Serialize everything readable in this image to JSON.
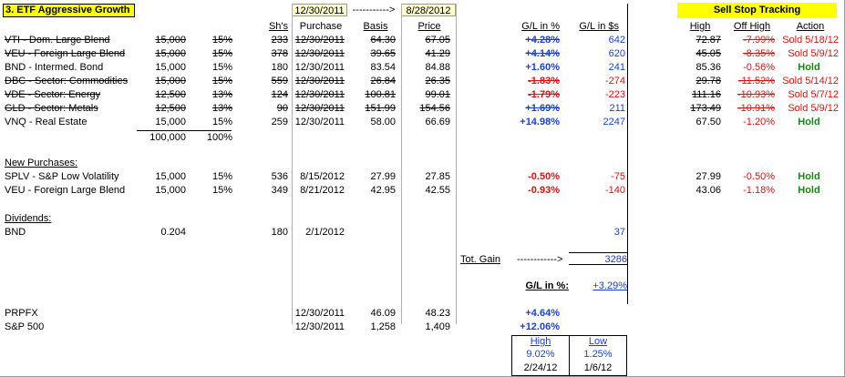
{
  "title": "3. ETF Aggressive Growth",
  "header": {
    "start_date": "12/30/2011",
    "arrow": "----------->",
    "end_date": "8/28/2012",
    "shares_label": "Sh's",
    "purchase_label": "Purchase",
    "basis_label": "Basis",
    "price_label": "Price",
    "gl_pct_label": "G/L in %",
    "gl_usd_label": "G/L in $s"
  },
  "sell_stop": {
    "title": "Sell Stop Tracking",
    "high_label": "High",
    "off_high_label": "Off High",
    "action_label": "Action"
  },
  "holdings": [
    {
      "name": "VTI - Dom. Large Blend",
      "amount": "15,000",
      "pct": "15%",
      "shares": "233",
      "purchase": "12/30/2011",
      "basis": "64.30",
      "price": "67.05",
      "gl_pct": "+4.28%",
      "gl_usd": "642",
      "high": "72.87",
      "off_high": "-7.99%",
      "action": "Sold 5/18/12",
      "struck": true
    },
    {
      "name": "VEU - Foreign Large Blend",
      "amount": "15,000",
      "pct": "15%",
      "shares": "378",
      "purchase": "12/30/2011",
      "basis": "39.65",
      "price": "41.29",
      "gl_pct": "+4.14%",
      "gl_usd": "620",
      "high": "45.05",
      "off_high": "-8.35%",
      "action": "Sold 5/9/12",
      "struck": true
    },
    {
      "name": "BND - Intermed. Bond",
      "amount": "15,000",
      "pct": "15%",
      "shares": "180",
      "purchase": "12/30/2011",
      "basis": "83.54",
      "price": "84.88",
      "gl_pct": "+1.60%",
      "gl_usd": "241",
      "high": "85.36",
      "off_high": "-0.56%",
      "action": "Hold",
      "struck": false
    },
    {
      "name": "DBC - Sector: Commodities",
      "amount": "15,000",
      "pct": "15%",
      "shares": "559",
      "purchase": "12/30/2011",
      "basis": "26.84",
      "price": "26.35",
      "gl_pct": "-1.83%",
      "gl_usd": "-274",
      "high": "29.78",
      "off_high": "-11.52%",
      "action": "Sold 5/14/12",
      "struck": true
    },
    {
      "name": "VDE - Sector: Energy",
      "amount": "12,500",
      "pct": "13%",
      "shares": "124",
      "purchase": "12/30/2011",
      "basis": "100.81",
      "price": "99.01",
      "gl_pct": "-1.79%",
      "gl_usd": "-223",
      "high": "111.16",
      "off_high": "-10.93%",
      "action": "Sold 5/7/12",
      "struck": true
    },
    {
      "name": "GLD - Sector: Metals",
      "amount": "12,500",
      "pct": "13%",
      "shares": "90",
      "purchase": "12/30/2011",
      "basis": "151.99",
      "price": "154.56",
      "gl_pct": "+1.69%",
      "gl_usd": "211",
      "high": "173.49",
      "off_high": "-10.91%",
      "action": "Sold 5/9/12",
      "struck": true
    },
    {
      "name": "VNQ - Real Estate",
      "amount": "15,000",
      "pct": "15%",
      "shares": "259",
      "purchase": "12/30/2011",
      "basis": "58.00",
      "price": "66.69",
      "gl_pct": "+14.98%",
      "gl_usd": "2247",
      "high": "67.50",
      "off_high": "-1.20%",
      "action": "Hold",
      "struck": false
    }
  ],
  "totals": {
    "amount": "100,000",
    "pct": "100%"
  },
  "new_purchases": {
    "label": "New Purchases:",
    "rows": [
      {
        "name": "SPLV - S&P Low Volatility",
        "amount": "15,000",
        "pct": "15%",
        "shares": "536",
        "purchase": "8/15/2012",
        "basis": "27.99",
        "price": "27.85",
        "gl_pct": "-0.50%",
        "gl_usd": "-75",
        "high": "27.99",
        "off_high": "-0.50%",
        "action": "Hold"
      },
      {
        "name": "VEU - Foreign Large Blend",
        "amount": "15,000",
        "pct": "15%",
        "shares": "349",
        "purchase": "8/21/2012",
        "basis": "42.95",
        "price": "42.55",
        "gl_pct": "-0.93%",
        "gl_usd": "-140",
        "high": "43.06",
        "off_high": "-1.18%",
        "action": "Hold"
      }
    ]
  },
  "dividends": {
    "label": "Dividends:",
    "row": {
      "name": "BND",
      "amount": "0.204",
      "shares": "180",
      "date": "2/1/2012",
      "gl_usd": "37"
    }
  },
  "summary": {
    "tot_gain_label": "Tot. Gain",
    "tot_gain_arrow": "------------>",
    "tot_gain_value": "3286",
    "gl_pct_label": "G/L in %:",
    "gl_pct_value": "+3.29%"
  },
  "benchmarks": [
    {
      "name": "PRPFX",
      "date": "12/30/2011",
      "basis": "46.09",
      "price": "48.23",
      "gl_pct": "+4.64%"
    },
    {
      "name": "S&P 500",
      "date": "12/30/2011",
      "basis": "1,258",
      "price": "1,409",
      "gl_pct": "+12.06%"
    }
  ],
  "range": {
    "high_label": "High",
    "low_label": "Low",
    "high_pct": "9.02%",
    "low_pct": "1.25%",
    "high_date": "2/24/12",
    "low_date": "1/6/12"
  },
  "colors": {
    "highlight": "#ffff00",
    "light_highlight": "#ffffcc",
    "gain": "#1a3fd6",
    "loss": "#e01010",
    "hold": "#138a13"
  }
}
